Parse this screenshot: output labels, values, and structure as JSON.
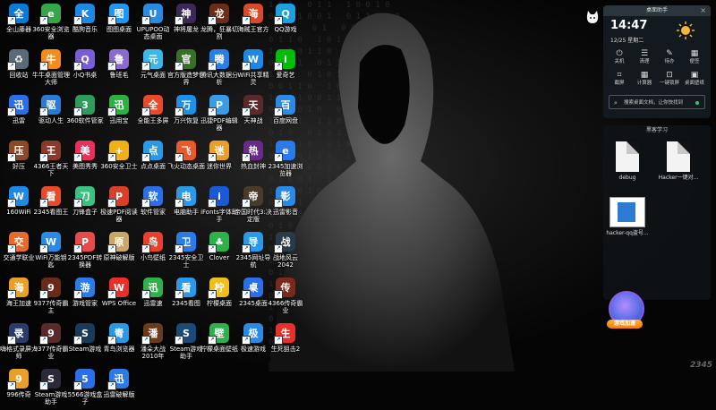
{
  "desktop": {
    "icons": [
      {
        "label": "全山藤器",
        "color": "#0a7ad6",
        "glyph": "全"
      },
      {
        "label": "360安全浏览器",
        "color": "#35a64a",
        "glyph": "e"
      },
      {
        "label": "酷狗音乐",
        "color": "#1e88e5",
        "glyph": "K"
      },
      {
        "label": "图图桌面",
        "color": "#2196f3",
        "glyph": "图"
      },
      {
        "label": "UPUPOO动态桌面",
        "color": "#2a8ce0",
        "glyph": "U"
      },
      {
        "label": "神将屠龙",
        "color": "#3a2a55",
        "glyph": "神"
      },
      {
        "label": "龙腾，狂暴切割",
        "color": "#6b2d1a",
        "glyph": "龙"
      },
      {
        "label": "海贼王官方",
        "color": "#d84a2a",
        "glyph": "海"
      },
      {
        "label": "QQ游戏",
        "color": "#1ca0e0",
        "glyph": "Q"
      },
      {
        "label": "回收站",
        "color": "#5a6a78",
        "glyph": "♻"
      },
      {
        "label": "牛牛桌面管理大师",
        "color": "#f28c1c",
        "glyph": "牛"
      },
      {
        "label": "小Q书桌",
        "color": "#7a5cd6",
        "glyph": "Q"
      },
      {
        "label": "鲁班毛",
        "color": "#8a6cd0",
        "glyph": "鲁"
      },
      {
        "label": "元气桌面",
        "color": "#3bb8e8",
        "glyph": "元"
      },
      {
        "label": "官方版造梦世界",
        "color": "#3a6f2a",
        "glyph": "官"
      },
      {
        "label": "腾讯大数据分析",
        "color": "#2a7ee8",
        "glyph": "腾"
      },
      {
        "label": "WiFi共享精灵",
        "color": "#1e88e5",
        "glyph": "W"
      },
      {
        "label": "爱奇艺",
        "color": "#00be06",
        "glyph": "i"
      },
      {
        "label": "迅雷",
        "color": "#2a6ee8",
        "glyph": "迅"
      },
      {
        "label": "驱动人生",
        "color": "#2a7ad6",
        "glyph": "驱"
      },
      {
        "label": "360软件管家",
        "color": "#2e9c5a",
        "glyph": "3"
      },
      {
        "label": "迅用宝",
        "color": "#2eb040",
        "glyph": "迅"
      },
      {
        "label": "全能王多屏",
        "color": "#e84a2a",
        "glyph": "全"
      },
      {
        "label": "万兴恢复",
        "color": "#1e90e8",
        "glyph": "万"
      },
      {
        "label": "迅捷PDF编辑器",
        "color": "#3a9be8",
        "glyph": "P"
      },
      {
        "label": "天神战",
        "color": "#5a2a2a",
        "glyph": "天"
      },
      {
        "label": "百度网盘",
        "color": "#2a8ae8",
        "glyph": "百"
      },
      {
        "label": "好压",
        "color": "#8a4a2a",
        "glyph": "压"
      },
      {
        "label": "4366王者天下",
        "color": "#8a3a2a",
        "glyph": "王"
      },
      {
        "label": "美图秀秀",
        "color": "#e8305a",
        "glyph": "美"
      },
      {
        "label": "360安全卫士",
        "color": "#f0b01a",
        "glyph": "+"
      },
      {
        "label": "点点桌面",
        "color": "#2a9ae8",
        "glyph": "点"
      },
      {
        "label": "飞火动态桌面",
        "color": "#e85a2a",
        "glyph": "飞"
      },
      {
        "label": "迷你世界",
        "color": "#e8a02a",
        "glyph": "迷"
      },
      {
        "label": "热血封神",
        "color": "#6a2a8a",
        "glyph": "热"
      },
      {
        "label": "2345加速浏览器",
        "color": "#2a7ae8",
        "glyph": "e"
      },
      {
        "label": "160WiFi",
        "color": "#1e8ae8",
        "glyph": "W"
      },
      {
        "label": "2345看图王",
        "color": "#e84a2a",
        "glyph": "看"
      },
      {
        "label": "刀锋盒子",
        "color": "#3ac080",
        "glyph": "刀"
      },
      {
        "label": "极速PDF阅读器",
        "color": "#d8402a",
        "glyph": "P"
      },
      {
        "label": "软件管家",
        "color": "#2a6ee8",
        "glyph": "软"
      },
      {
        "label": "电脑助手",
        "color": "#2a9ae8",
        "glyph": "电"
      },
      {
        "label": "iFonts字体助手",
        "color": "#1a5ad6",
        "glyph": "i"
      },
      {
        "label": "帝国时代3:决定版",
        "color": "#4a3a2a",
        "glyph": "帝"
      },
      {
        "label": "迅雷影音",
        "color": "#2a8ae8",
        "glyph": "影"
      },
      {
        "label": "交通学联业",
        "color": "#e86a2a",
        "glyph": "交"
      },
      {
        "label": "WiFi万能钥匙",
        "color": "#2a8ae8",
        "glyph": "W"
      },
      {
        "label": "2345PDF转换器",
        "color": "#e84a4a",
        "glyph": "P"
      },
      {
        "label": "原神破解版",
        "color": "#c8a86a",
        "glyph": "原"
      },
      {
        "label": "小鸟壁纸",
        "color": "#e8402a",
        "glyph": "鸟"
      },
      {
        "label": "2345安全卫士",
        "color": "#2a7ae8",
        "glyph": "卫"
      },
      {
        "label": "Clover",
        "color": "#2eb04a",
        "glyph": "♣"
      },
      {
        "label": "2345网址导航",
        "color": "#2a9ae8",
        "glyph": "导"
      },
      {
        "label": "战地风云2042",
        "color": "#2a3a4a",
        "glyph": "战"
      },
      {
        "label": "海王加速",
        "color": "#e8a02a",
        "glyph": "海"
      },
      {
        "label": "9377传奇霸主",
        "color": "#6a2a1a",
        "glyph": "9"
      },
      {
        "label": "游戏管家",
        "color": "#2a7ae8",
        "glyph": "游"
      },
      {
        "label": "WPS Office",
        "color": "#e8302a",
        "glyph": "W"
      },
      {
        "label": "迅雷速",
        "color": "#2eb04a",
        "glyph": "迅"
      },
      {
        "label": "2345看图",
        "color": "#2a9ae8",
        "glyph": "看"
      },
      {
        "label": "柠檬桌面",
        "color": "#f0c01a",
        "glyph": "柠"
      },
      {
        "label": "2345桌面",
        "color": "#2a6ee8",
        "glyph": "桌"
      },
      {
        "label": "4366传奇霸业",
        "color": "#7a2a1a",
        "glyph": "传"
      },
      {
        "label": "嗨格式录屏大师",
        "color": "#2a3a6a",
        "glyph": "录"
      },
      {
        "label": "9377传奇霸业",
        "color": "#5a2a2a",
        "glyph": "9"
      },
      {
        "label": "Steam游戏",
        "color": "#1a3a5a",
        "glyph": "S"
      },
      {
        "label": "青鸟浏览器",
        "color": "#2a9ae8",
        "glyph": "青"
      },
      {
        "label": "潘朵大战2010年",
        "color": "#6a3a1a",
        "glyph": "潘"
      },
      {
        "label": "Steam游戏助手",
        "color": "#1a4a7a",
        "glyph": "S"
      },
      {
        "label": "柠檬桌面壁纸",
        "color": "#2eb04a",
        "glyph": "壁"
      },
      {
        "label": "极速游戏",
        "color": "#2a8ae8",
        "glyph": "极"
      },
      {
        "label": "生死狙击2",
        "color": "#e8302a",
        "glyph": "生"
      },
      {
        "label": "996传奇",
        "color": "#e8a02a",
        "glyph": "9"
      },
      {
        "label": "Steam游戏助手",
        "color": "#2a2a3a",
        "glyph": "S"
      },
      {
        "label": "5566游戏盒子",
        "color": "#2a6ee8",
        "glyph": "5"
      },
      {
        "label": "迅雷破解版",
        "color": "#2a7ae8",
        "glyph": "迅"
      }
    ]
  },
  "widget": {
    "title": "桌面助手",
    "time": "14:47",
    "date": "12/25 星期二",
    "temp": "",
    "tools": [
      {
        "label": "关机",
        "glyph": "⏻"
      },
      {
        "label": "清理",
        "glyph": "☰"
      },
      {
        "label": "待办",
        "glyph": "✎"
      },
      {
        "label": "便签",
        "glyph": "▦"
      },
      {
        "label": "截屏",
        "glyph": "⌗"
      },
      {
        "label": "计算器",
        "glyph": "▦"
      },
      {
        "label": "一键锁屏",
        "glyph": "⊡"
      },
      {
        "label": "桌面壁纸",
        "glyph": "▣"
      }
    ],
    "search_placeholder": "搜索桌面文档，让你快找到"
  },
  "folder": {
    "title": "黑客学习",
    "files": [
      {
        "label": "debug"
      },
      {
        "label": "Hacker一键对..."
      },
      {
        "label": "hacker-qq盗号..."
      }
    ]
  },
  "mascot": {
    "label": "游戏加速"
  },
  "watermark": "2345"
}
